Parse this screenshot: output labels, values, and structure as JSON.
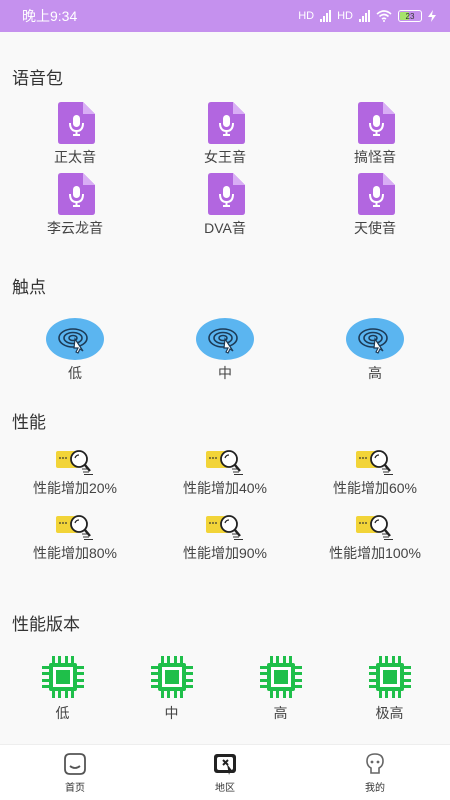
{
  "status_bar": {
    "time": "晚上9:34",
    "network_1": "HD",
    "network_2": "HD",
    "battery": "23"
  },
  "sections": {
    "voice": {
      "title": "语音包",
      "items": [
        {
          "label": "正太音",
          "icon": "microphone-file-icon"
        },
        {
          "label": "女王音",
          "icon": "microphone-file-icon"
        },
        {
          "label": "搞怪音",
          "icon": "microphone-file-icon"
        },
        {
          "label": "李云龙音",
          "icon": "microphone-file-icon"
        },
        {
          "label": "DVA音",
          "icon": "microphone-file-icon"
        },
        {
          "label": "天使音",
          "icon": "microphone-file-icon"
        }
      ]
    },
    "touch": {
      "title": "触点",
      "items": [
        {
          "label": "低",
          "icon": "touch-cursor-icon"
        },
        {
          "label": "中",
          "icon": "touch-cursor-icon"
        },
        {
          "label": "高",
          "icon": "touch-cursor-icon"
        }
      ]
    },
    "performance": {
      "title": "性能",
      "items": [
        {
          "label": "性能增加20%",
          "icon": "search-folder-icon"
        },
        {
          "label": "性能增加40%",
          "icon": "search-folder-icon"
        },
        {
          "label": "性能增加60%",
          "icon": "search-folder-icon"
        },
        {
          "label": "性能增加80%",
          "icon": "search-folder-icon"
        },
        {
          "label": "性能增加90%",
          "icon": "search-folder-icon"
        },
        {
          "label": "性能增加100%",
          "icon": "search-folder-icon"
        }
      ]
    },
    "version": {
      "title": "性能版本",
      "items": [
        {
          "label": "低",
          "icon": "chip-icon"
        },
        {
          "label": "中",
          "icon": "chip-icon"
        },
        {
          "label": "高",
          "icon": "chip-icon"
        },
        {
          "label": "极高",
          "icon": "chip-icon"
        }
      ]
    }
  },
  "bottom_nav": {
    "items": [
      {
        "label": "首页",
        "icon": "home-face-icon"
      },
      {
        "label": "地区",
        "icon": "region-icon"
      },
      {
        "label": "我的",
        "icon": "profile-icon"
      }
    ]
  },
  "colors": {
    "status_bar": "#c591ee",
    "voice_icon": "#b266e0",
    "touch_icon": "#5bb5f0",
    "perf_icon": "#f2d438",
    "chip_icon": "#1fbf4a"
  }
}
